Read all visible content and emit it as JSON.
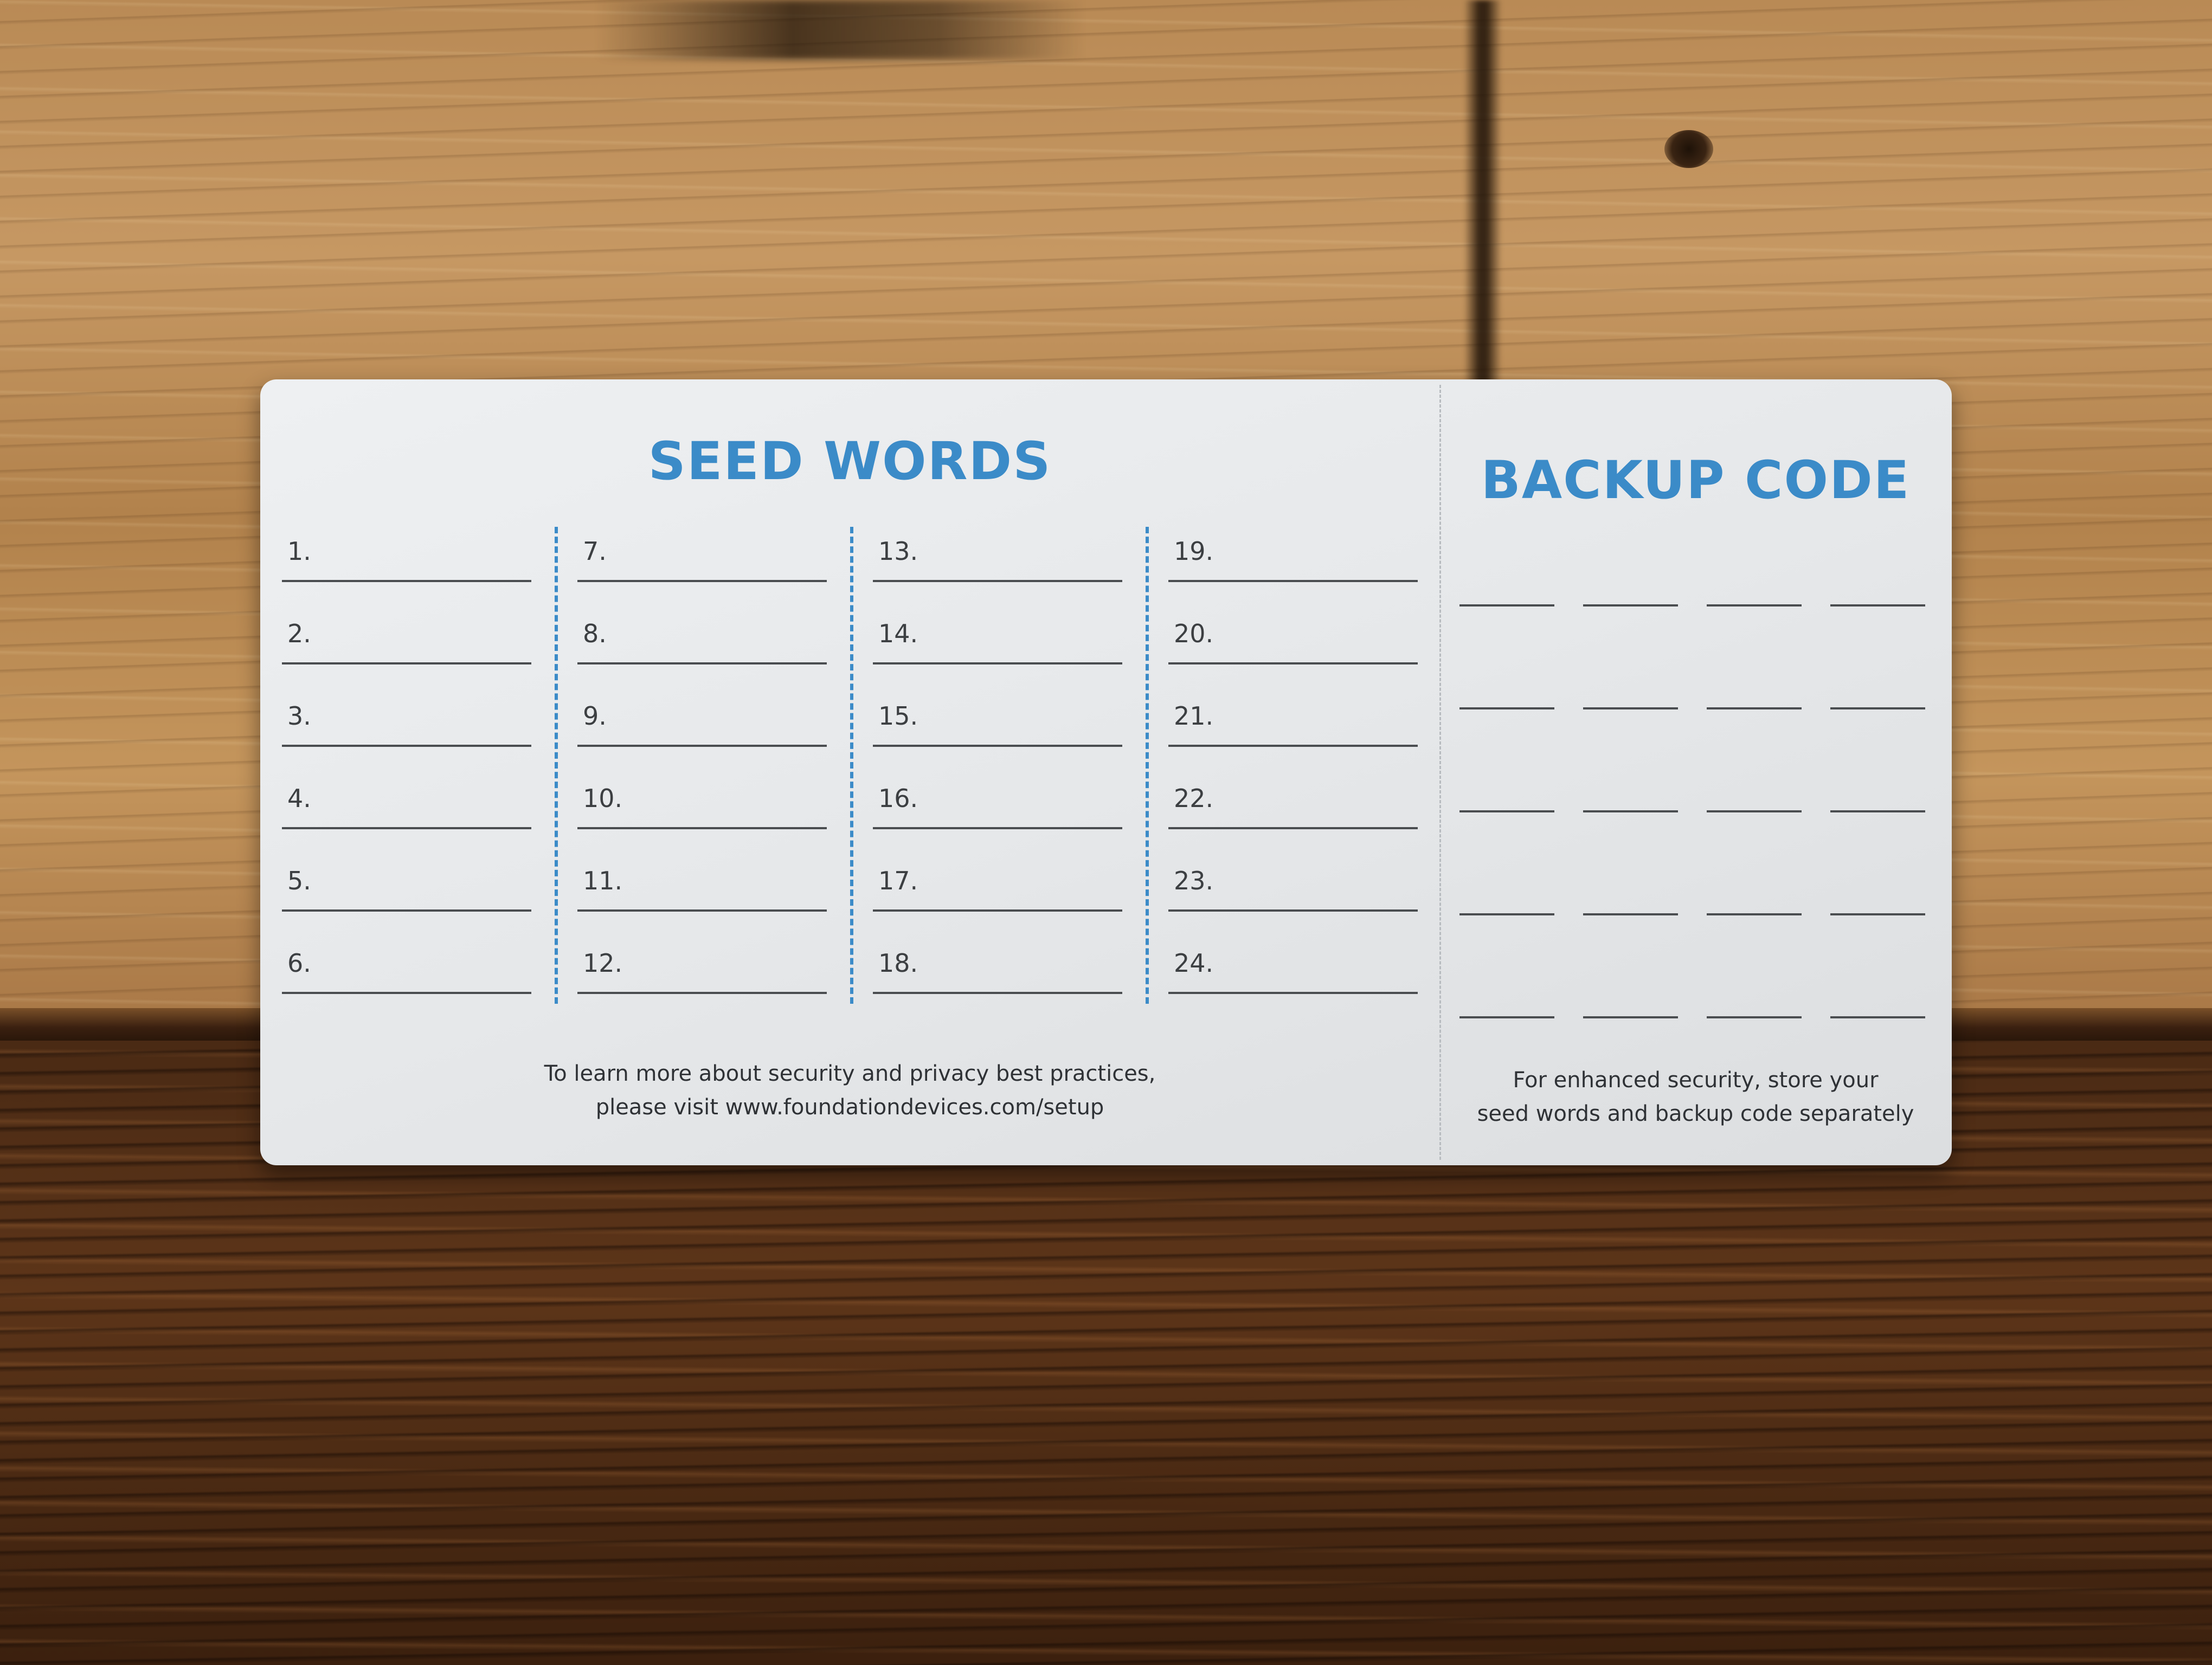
{
  "card": {
    "seed_title": "SEED WORDS",
    "backup_title": "BACKUP CODE",
    "seed_columns": [
      [
        "1.",
        "2.",
        "3.",
        "4.",
        "5.",
        "6."
      ],
      [
        "7.",
        "8.",
        "9.",
        "10.",
        "11.",
        "12."
      ],
      [
        "13.",
        "14.",
        "15.",
        "16.",
        "17.",
        "18."
      ],
      [
        "19.",
        "20.",
        "21.",
        "22.",
        "23.",
        "24."
      ]
    ],
    "seed_note_line1": "To learn more about security and privacy best practices,",
    "seed_note_line2": "please visit www.foundationdevices.com/setup",
    "backup_note_line1": "For enhanced security, store your",
    "backup_note_line2": "seed words and backup code separately",
    "backup_rows": 5,
    "backup_groups_per_row": 4
  },
  "colors": {
    "accent": "#3b8bc8",
    "card": "#e6e8ea",
    "text": "#3c3f42"
  }
}
